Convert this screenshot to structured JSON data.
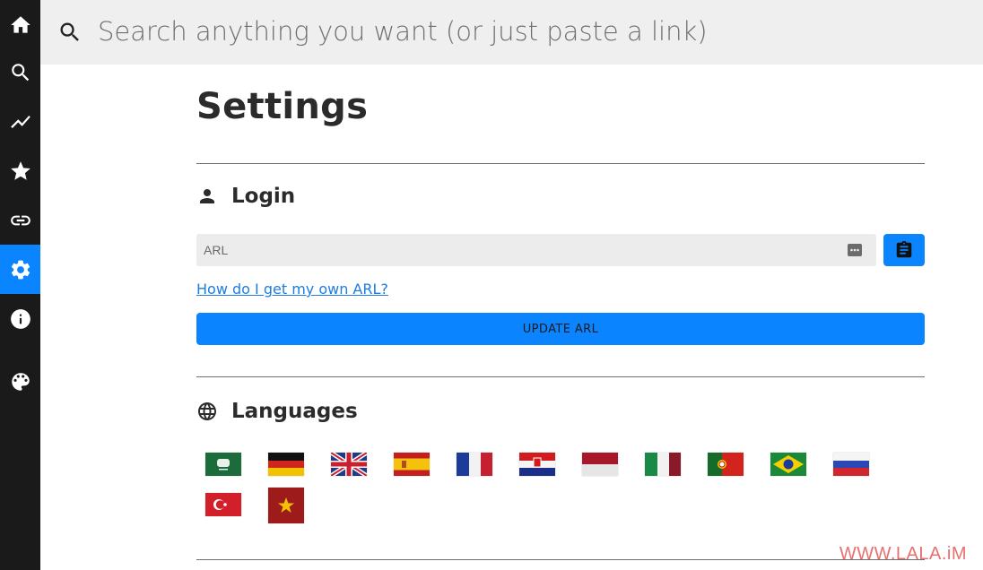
{
  "sidebar": {
    "items": [
      {
        "icon": "home-icon"
      },
      {
        "icon": "search-icon"
      },
      {
        "icon": "trending-icon"
      },
      {
        "icon": "star-icon"
      },
      {
        "icon": "link-icon"
      },
      {
        "icon": "gear-icon",
        "active": true
      },
      {
        "icon": "info-icon"
      },
      {
        "icon": "palette-icon"
      }
    ],
    "active_color": "#0a84ff",
    "background": "#1a1a1a"
  },
  "search": {
    "placeholder": "Search anything you want (or just paste a link)"
  },
  "page": {
    "title": "Settings"
  },
  "login": {
    "title": "Login",
    "arl_placeholder": "ARL",
    "help_link": "How do I get my own ARL?",
    "update_button": "UPDATE ARL"
  },
  "languages": {
    "title": "Languages",
    "flags": [
      "ar",
      "de",
      "en",
      "es",
      "fr",
      "hr",
      "id",
      "it",
      "pt-pt",
      "pt-br",
      "ru",
      "tr",
      "vn"
    ]
  },
  "watermark": "WWW.LALA.iM"
}
